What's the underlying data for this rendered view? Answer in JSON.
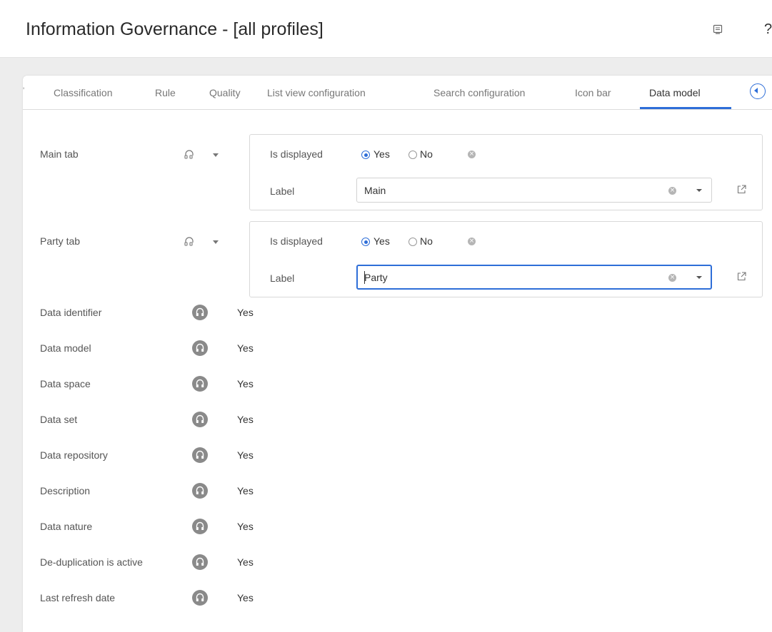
{
  "header": {
    "title": "Information Governance - [all profiles]",
    "comment_icon": "comment-icon",
    "help_label": "?"
  },
  "tabs": [
    {
      "label": "Classification",
      "active": false
    },
    {
      "label": "Rule",
      "active": false
    },
    {
      "label": "Quality",
      "active": false
    },
    {
      "label": "List view configuration",
      "active": false
    },
    {
      "label": "Search configuration",
      "active": false
    },
    {
      "label": "Icon bar",
      "active": false
    },
    {
      "label": "Data model",
      "active": true
    }
  ],
  "accent_color": "#2e6ed8",
  "groups": [
    {
      "label": "Main tab",
      "is_displayed_label": "Is displayed",
      "yes_label": "Yes",
      "no_label": "No",
      "selected": "Yes",
      "label_field_label": "Label",
      "label_value": "Main"
    },
    {
      "label": "Party tab",
      "is_displayed_label": "Is displayed",
      "yes_label": "Yes",
      "no_label": "No",
      "selected": "Yes",
      "label_field_label": "Label",
      "label_value": "Party"
    }
  ],
  "rows": [
    {
      "label": "Data identifier",
      "value": "Yes"
    },
    {
      "label": "Data model",
      "value": "Yes"
    },
    {
      "label": "Data space",
      "value": "Yes"
    },
    {
      "label": "Data set",
      "value": "Yes"
    },
    {
      "label": "Data repository",
      "value": "Yes"
    },
    {
      "label": "Description",
      "value": "Yes"
    },
    {
      "label": "Data nature",
      "value": "Yes"
    },
    {
      "label": "De-duplication is active",
      "value": "Yes"
    },
    {
      "label": "Last refresh date",
      "value": "Yes"
    }
  ]
}
